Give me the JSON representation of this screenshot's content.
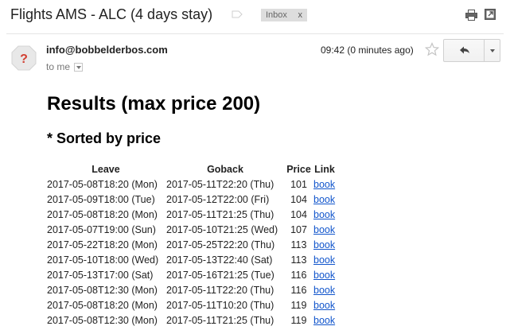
{
  "header": {
    "subject": "Flights AMS - ALC (4 days stay)",
    "label_chip": "Inbox",
    "label_chip_remove": "x"
  },
  "message": {
    "sender": "info@bobbelderbos.com",
    "recipient": "to me",
    "timestamp": "09:42 (0 minutes ago)",
    "avatar_glyph": "?"
  },
  "body": {
    "title": "Results (max price 200)",
    "subtitle": "* Sorted by price",
    "table": {
      "headers": [
        "Leave",
        "Goback",
        "Price",
        "Link"
      ],
      "rows": [
        {
          "leave": "2017-05-08T18:20 (Mon)",
          "goback": "2017-05-11T22:20 (Thu)",
          "price": "101",
          "link": "book"
        },
        {
          "leave": "2017-05-09T18:00 (Tue)",
          "goback": "2017-05-12T22:00 (Fri)",
          "price": "104",
          "link": "book"
        },
        {
          "leave": "2017-05-08T18:20 (Mon)",
          "goback": "2017-05-11T21:25 (Thu)",
          "price": "104",
          "link": "book"
        },
        {
          "leave": "2017-05-07T19:00 (Sun)",
          "goback": "2017-05-10T21:25 (Wed)",
          "price": "107",
          "link": "book"
        },
        {
          "leave": "2017-05-22T18:20 (Mon)",
          "goback": "2017-05-25T22:20 (Thu)",
          "price": "113",
          "link": "book"
        },
        {
          "leave": "2017-05-10T18:00 (Wed)",
          "goback": "2017-05-13T22:40 (Sat)",
          "price": "113",
          "link": "book"
        },
        {
          "leave": "2017-05-13T17:00 (Sat)",
          "goback": "2017-05-16T21:25 (Tue)",
          "price": "116",
          "link": "book"
        },
        {
          "leave": "2017-05-08T12:30 (Mon)",
          "goback": "2017-05-11T22:20 (Thu)",
          "price": "116",
          "link": "book"
        },
        {
          "leave": "2017-05-08T18:20 (Mon)",
          "goback": "2017-05-11T10:20 (Thu)",
          "price": "119",
          "link": "book"
        },
        {
          "leave": "2017-05-08T12:30 (Mon)",
          "goback": "2017-05-11T21:25 (Thu)",
          "price": "119",
          "link": "book"
        }
      ]
    }
  },
  "icons": {
    "label": "label-tag-icon",
    "print": "print-icon",
    "new_window": "new-window-icon",
    "star": "star-icon",
    "reply": "reply-arrow-icon",
    "more": "chevron-down-icon",
    "avatar": "default-avatar-icon"
  },
  "colors": {
    "link": "#1155cc",
    "chip_bg": "#dddddd",
    "avatar_red": "#d23f31"
  }
}
